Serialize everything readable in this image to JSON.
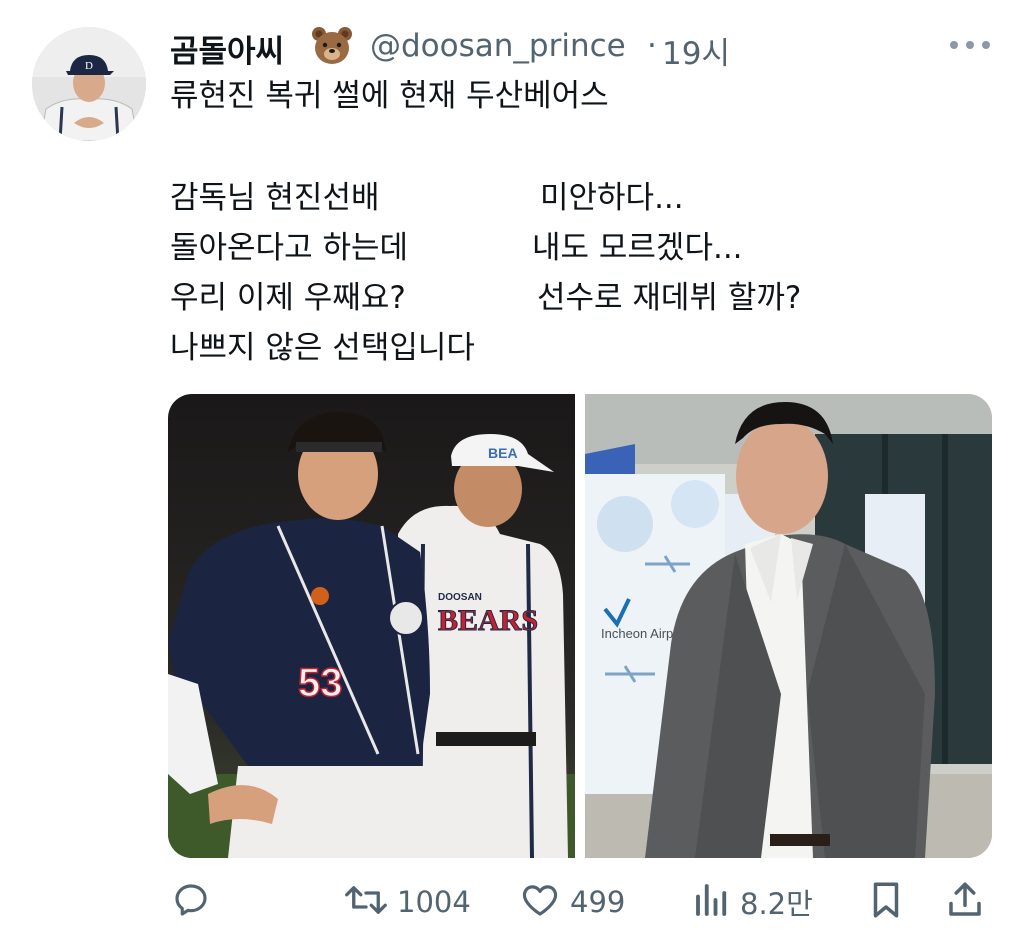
{
  "author": {
    "display_name": "곰돌아씨",
    "handle": "@doosan_prince",
    "separator": "·",
    "time": "19시"
  },
  "tweet": {
    "line1": "류현진 복귀 썰에 현재 두산베어스",
    "rows": [
      {
        "left": "감독님 현진선배",
        "right": "미안하다..."
      },
      {
        "left": "돌아온다고 하는데",
        "right": "내도 모르겠다..."
      },
      {
        "left": "우리 이제 우째요?",
        "right": "선수로 재데뷔 할까?"
      },
      {
        "left": "나쁘지 않은 선택입니다",
        "right": ""
      }
    ]
  },
  "media": {
    "left_photo": {
      "jersey_number": "53",
      "team_wordmark": "BEARS",
      "team_small": "DOOSAN",
      "cap_text": "BEA"
    },
    "right_photo": {
      "sign_text": "Incheon Airport"
    }
  },
  "stats": {
    "retweets": "1004",
    "likes": "499",
    "views": "8.2만"
  },
  "icons": {
    "reply": "reply-icon",
    "retweet": "retweet-icon",
    "like": "heart-icon",
    "views": "views-icon",
    "bookmark": "bookmark-icon",
    "share": "share-icon",
    "more": "more-icon",
    "emoji": "bear-emoji-icon"
  },
  "colors": {
    "text": "#0f1419",
    "muted": "#536471",
    "navy": "#1b2440",
    "red": "#c8202f"
  }
}
